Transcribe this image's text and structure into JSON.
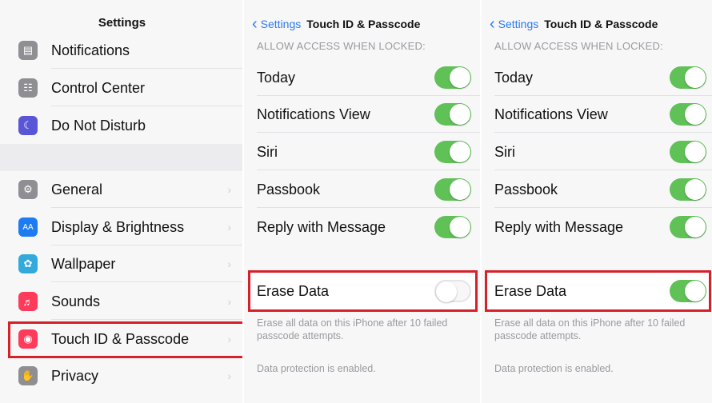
{
  "colors": {
    "accent": "#2a7bf6",
    "switch_on": "#5fc156",
    "highlight": "#d6202a"
  },
  "left": {
    "title": "Settings",
    "items": [
      {
        "label": "Notifications",
        "icon": "notifications-icon",
        "color": "#8e8e93"
      },
      {
        "label": "Control Center",
        "icon": "control-center-icon",
        "color": "#8e8e93"
      },
      {
        "label": "Do Not Disturb",
        "icon": "moon-icon",
        "color": "#5856d6"
      },
      {
        "label": "General",
        "icon": "gear-icon",
        "color": "#8e8e93"
      },
      {
        "label": "Display & Brightness",
        "icon": "display-brightness-icon",
        "color": "#1e7cf2"
      },
      {
        "label": "Wallpaper",
        "icon": "wallpaper-icon",
        "color": "#34aadc"
      },
      {
        "label": "Sounds",
        "icon": "speaker-icon",
        "color": "#ff3b5c"
      },
      {
        "label": "Touch ID & Passcode",
        "icon": "fingerprint-icon",
        "color": "#ff3b5c"
      },
      {
        "label": "Privacy",
        "icon": "hand-icon",
        "color": "#8e8e93"
      }
    ]
  },
  "detail_panels": [
    {
      "nav": {
        "back": "Settings",
        "title": "Touch ID & Passcode"
      },
      "section_header": "ALLOW ACCESS WHEN LOCKED:",
      "toggles": [
        {
          "label": "Today",
          "on": true
        },
        {
          "label": "Notifications View",
          "on": true
        },
        {
          "label": "Siri",
          "on": true
        },
        {
          "label": "Passbook",
          "on": true
        },
        {
          "label": "Reply with Message",
          "on": true
        }
      ],
      "erase": {
        "label": "Erase Data",
        "on": false
      },
      "footer_1": "Erase all data on this iPhone after 10 failed passcode attempts.",
      "footer_2": "Data protection is enabled."
    },
    {
      "nav": {
        "back": "Settings",
        "title": "Touch ID & Passcode"
      },
      "section_header": "ALLOW ACCESS WHEN LOCKED:",
      "toggles": [
        {
          "label": "Today",
          "on": true
        },
        {
          "label": "Notifications View",
          "on": true
        },
        {
          "label": "Siri",
          "on": true
        },
        {
          "label": "Passbook",
          "on": true
        },
        {
          "label": "Reply with Message",
          "on": true
        }
      ],
      "erase": {
        "label": "Erase Data",
        "on": true
      },
      "footer_1": "Erase all data on this iPhone after 10 failed passcode attempts.",
      "footer_2": "Data protection is enabled."
    }
  ]
}
